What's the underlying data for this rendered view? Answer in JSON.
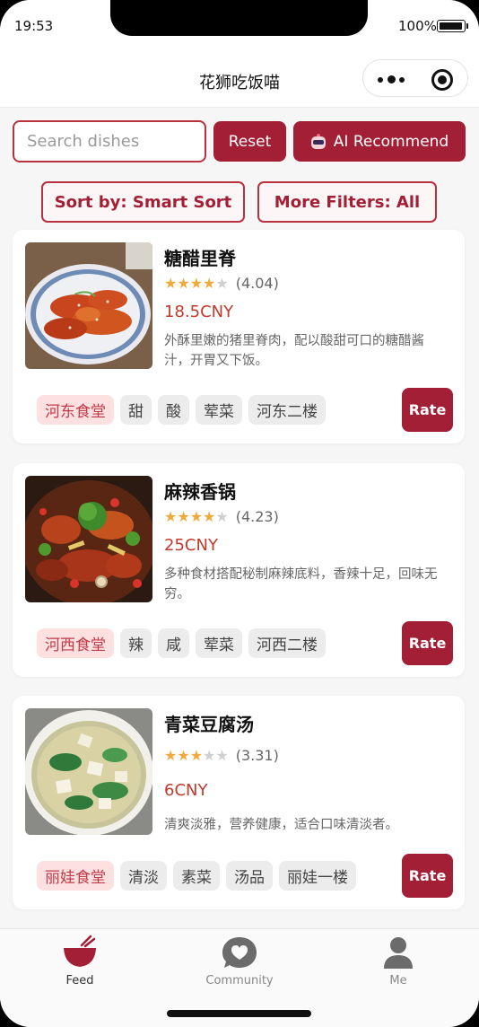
{
  "status_bar": {
    "time": "19:53",
    "battery": "100%"
  },
  "nav": {
    "title": "花狮吃饭喵"
  },
  "search": {
    "placeholder": "Search dishes",
    "reset_label": "Reset",
    "ai_label": "AI Recommend"
  },
  "filters": {
    "sort_label": "Sort by:  Smart Sort",
    "more_label": "More Filters:   All"
  },
  "colors": {
    "accent": "#a31f35",
    "price": "#c0392b",
    "star": "#f2a93b",
    "tag_canteen_bg": "#fde0e0"
  },
  "dishes": [
    {
      "name": "糖醋里脊",
      "stars": 4,
      "rating": "(4.04)",
      "price": "18.5CNY",
      "desc": "外酥里嫩的猪里脊肉，配以酸甜可口的糖醋酱汁，开胃又下饭。",
      "tags": [
        "河东食堂",
        "甜",
        "酸",
        "荤菜",
        "河东二楼"
      ],
      "rate_label": "Rate"
    },
    {
      "name": "麻辣香锅",
      "stars": 4,
      "rating": "(4.23)",
      "price": "25CNY",
      "desc": "多种食材搭配秘制麻辣底料，香辣十足，回味无穷。",
      "tags": [
        "河西食堂",
        "辣",
        "咸",
        "荤菜",
        "河西二楼"
      ],
      "rate_label": "Rate"
    },
    {
      "name": "青菜豆腐汤",
      "stars": 3,
      "rating": "(3.31)",
      "price": "6CNY",
      "desc": "清爽淡雅，营养健康，适合口味清淡者。",
      "tags": [
        "丽娃食堂",
        "清淡",
        "素菜",
        "汤品",
        "丽娃一楼"
      ],
      "rate_label": "Rate"
    }
  ],
  "tabbar": {
    "items": [
      {
        "label": "Feed",
        "icon": "bowl-icon",
        "active": true
      },
      {
        "label": "Community",
        "icon": "chat-bubble-icon",
        "active": false
      },
      {
        "label": "Me",
        "icon": "person-icon",
        "active": false
      }
    ]
  }
}
